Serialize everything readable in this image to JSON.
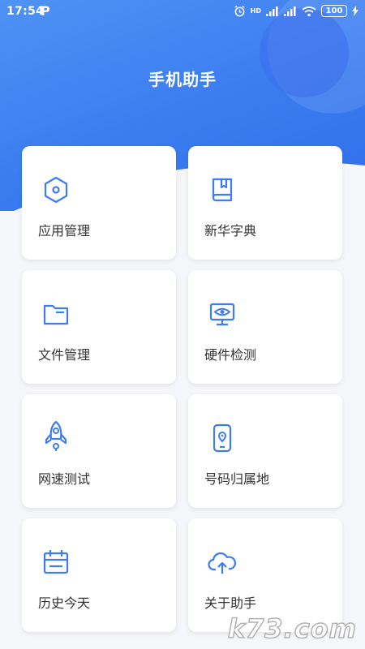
{
  "status_bar": {
    "time": "17:54",
    "app_icon": "P",
    "network_label": "HD",
    "battery": "100"
  },
  "page_title": "手机助手",
  "features": [
    {
      "label": "应用管理",
      "icon": "hexagon-icon"
    },
    {
      "label": "新华字典",
      "icon": "book-icon"
    },
    {
      "label": "文件管理",
      "icon": "folder-icon"
    },
    {
      "label": "硬件检测",
      "icon": "monitor-eye-icon"
    },
    {
      "label": "网速测试",
      "icon": "rocket-icon"
    },
    {
      "label": "号码归属地",
      "icon": "phone-location-icon"
    },
    {
      "label": "历史今天",
      "icon": "calendar-icon"
    },
    {
      "label": "关于助手",
      "icon": "cloud-upload-icon"
    }
  ],
  "watermark": "k73.com",
  "colors": {
    "accent": "#3a7cf0",
    "icon": "#3d7cf2"
  }
}
